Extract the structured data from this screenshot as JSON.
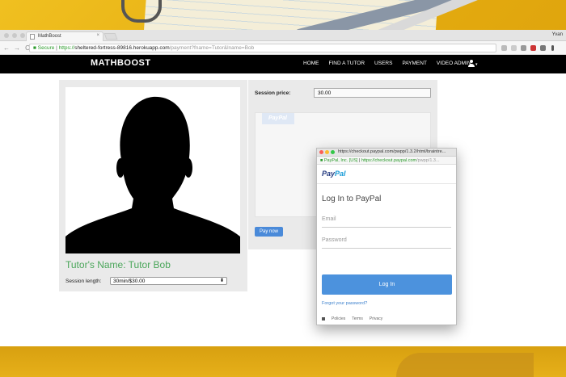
{
  "browser": {
    "tab_title": "MathBoost",
    "tab_close": "×",
    "user": "Yvan",
    "url": {
      "secure_label": "Secure",
      "scheme": "https://",
      "host": "sheltered-fortress-89816.herokuapp.com",
      "path": "/payment?fname=Tutor&lname=Bob"
    },
    "nav_back": "←",
    "nav_forward": "→",
    "nav_reload": "C"
  },
  "site": {
    "brand": "MATHBOOST",
    "menu": [
      "HOME",
      "FIND A TUTOR",
      "USERS",
      "PAYMENT",
      "VIDEO ADMIN"
    ],
    "user_caret": "▾"
  },
  "tutor": {
    "name": "Tutor's Name: Tutor Bob",
    "session_length_label": "Session length:",
    "session_length_value": "30min/$30.00",
    "select_arrow": "⬍"
  },
  "payment": {
    "price_label": "Session price:",
    "price_value": "30.00",
    "paypal_tab": "PayPal",
    "pay_button": "Pay now"
  },
  "popup": {
    "title": "https://checkout.paypal.com/pwpp/1.3.2/html/braintre...",
    "company": "PayPal, Inc. [US]",
    "url_host": "https://checkout.paypal.com",
    "url_path": "/pwpp/1.3...",
    "logo_pay": "Pay",
    "logo_pal": "Pal",
    "heading": "Log In to PayPal",
    "email_placeholder": "Email",
    "password_placeholder": "Password",
    "login_button": "Log In",
    "forgot": "Forgot your password?",
    "footer": [
      "Policies",
      "Terms",
      "Privacy"
    ]
  },
  "colors": {
    "accent_green": "#4aa65a",
    "paypal_blue": "#4c92dd",
    "nav_black": "#000000"
  }
}
